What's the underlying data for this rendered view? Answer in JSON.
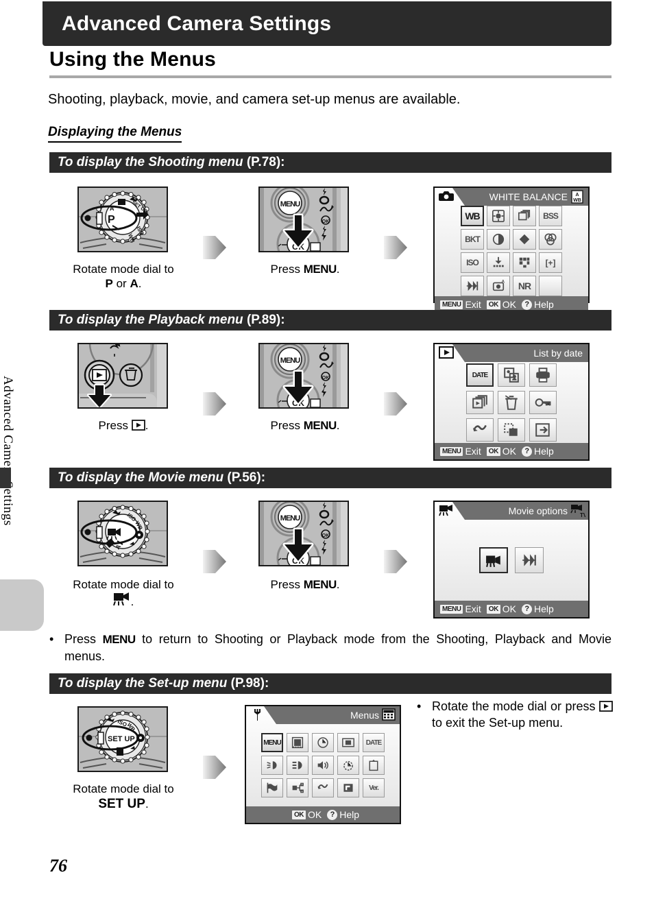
{
  "sidebar": {
    "vertical_label": "Advanced Camera Settings"
  },
  "header": {
    "chapter": "Advanced Camera Settings",
    "title": "Using the Menus",
    "intro": "Shooting, playback, movie, and camera set-up menus are available.",
    "subhead": "Displaying the Menus"
  },
  "page_number": "76",
  "sections": [
    {
      "id": "shooting",
      "bar_label": "To display the Shooting menu",
      "bar_page": "(P.78):",
      "steps": [
        {
          "caption_line1": "Rotate mode dial to",
          "caption_line2_pre": "",
          "caption_bold": "P",
          "caption_mid": " or ",
          "caption_bold2": "A",
          "caption_end": "."
        },
        {
          "caption_line1": "Press",
          "caption_key": "MENU",
          "caption_end": "."
        }
      ],
      "dial_selected": "P",
      "dial_labels": [
        "P",
        "A",
        "SET UP",
        "ISO",
        "WB"
      ],
      "lcd": {
        "mode_icon": "camera-icon",
        "title": "WHITE BALANCE",
        "right_icon": "auto-wb-icon",
        "columns": 4,
        "cells": [
          {
            "glyph": "WB",
            "name": "white-balance",
            "selected": true
          },
          {
            "glyph": "metering",
            "name": "metering",
            "selected": false
          },
          {
            "glyph": "continuous",
            "name": "continuous",
            "selected": false
          },
          {
            "glyph": "BSS",
            "name": "best-shot-selector",
            "selected": false
          },
          {
            "glyph": "BKT",
            "name": "bracketing",
            "selected": false
          },
          {
            "glyph": "contrast",
            "name": "image-adjustment",
            "selected": false
          },
          {
            "glyph": "sharpness",
            "name": "image-sharpening",
            "selected": false
          },
          {
            "glyph": "saturation",
            "name": "saturation-control",
            "selected": false
          },
          {
            "glyph": "ISO",
            "name": "iso-sensitivity",
            "selected": false
          },
          {
            "glyph": "imagequality",
            "name": "image-quality",
            "selected": false
          },
          {
            "glyph": "imagesize",
            "name": "image-size",
            "selected": false
          },
          {
            "glyph": "afarea",
            "name": "af-area-mode",
            "selected": false
          },
          {
            "glyph": "convertor",
            "name": "lens-convertor",
            "selected": false
          },
          {
            "glyph": "auto-bracket",
            "name": "auto-exposure",
            "selected": false
          },
          {
            "glyph": "NR",
            "name": "noise-reduction",
            "selected": false
          },
          {
            "glyph": "",
            "name": "empty-cell",
            "selected": false
          }
        ],
        "footer": [
          {
            "key": "MENU",
            "label": "Exit"
          },
          {
            "key": "OK",
            "label": "OK"
          },
          {
            "key": "?",
            "label": "Help"
          }
        ]
      }
    },
    {
      "id": "playback",
      "bar_label": "To display the Playback menu",
      "bar_page": "(P.89):",
      "steps": [
        {
          "caption_line1": "Press",
          "caption_key": "playback-icon",
          "caption_end": "."
        },
        {
          "caption_line1": "Press",
          "caption_key": "MENU",
          "caption_end": "."
        }
      ],
      "lcd": {
        "mode_icon": "playback-icon",
        "title": "List by date",
        "right_icon": "",
        "columns": 3,
        "cells": [
          {
            "glyph": "DATE",
            "name": "list-by-date",
            "selected": true
          },
          {
            "glyph": "slideshow-copy",
            "name": "small-picture",
            "selected": false
          },
          {
            "glyph": "printset",
            "name": "print-set",
            "selected": false
          },
          {
            "glyph": "slideshow",
            "name": "slide-show",
            "selected": false
          },
          {
            "glyph": "delete",
            "name": "delete",
            "selected": false
          },
          {
            "glyph": "protect",
            "name": "protect",
            "selected": false
          },
          {
            "glyph": "dscan",
            "name": "d-lighting",
            "selected": false
          },
          {
            "glyph": "resize",
            "name": "small-picture-resize",
            "selected": false
          },
          {
            "glyph": "copy",
            "name": "copy",
            "selected": false
          }
        ],
        "footer": [
          {
            "key": "MENU",
            "label": "Exit"
          },
          {
            "key": "OK",
            "label": "OK"
          },
          {
            "key": "?",
            "label": "Help"
          }
        ]
      }
    },
    {
      "id": "movie",
      "bar_label": "To display the Movie menu",
      "bar_page": "(P.56):",
      "steps": [
        {
          "caption_line1": "Rotate mode dial to",
          "caption_key": "movie-icon",
          "caption_end": "."
        },
        {
          "caption_line1": "Press",
          "caption_key": "MENU",
          "caption_end": "."
        }
      ],
      "lcd": {
        "mode_icon": "movie-icon",
        "title": "Movie options",
        "right_icon": "tv-movie-icon",
        "columns": 2,
        "cells": [
          {
            "glyph": "movie",
            "name": "movie-option",
            "selected": true
          },
          {
            "glyph": "convertor",
            "name": "electronic-vr",
            "selected": false
          }
        ],
        "footer": [
          {
            "key": "MENU",
            "label": "Exit"
          },
          {
            "key": "OK",
            "label": "OK"
          },
          {
            "key": "?",
            "label": "Help"
          }
        ]
      }
    },
    {
      "id": "setup",
      "bar_label": "To display the Set-up menu",
      "bar_page": "(P.98):",
      "steps": [
        {
          "caption_line1": "Rotate mode dial to",
          "caption_bold": "SET UP",
          "caption_end": "."
        }
      ],
      "lcd": {
        "mode_icon": "wrench-icon",
        "title": "Menus",
        "right_icon": "menus-grid-icon",
        "columns": 5,
        "cells": [
          {
            "glyph": "MENU",
            "name": "menus",
            "selected": true
          },
          {
            "glyph": "welcome",
            "name": "welcome-screen",
            "selected": false
          },
          {
            "glyph": "clock",
            "name": "date",
            "selected": false
          },
          {
            "glyph": "monitor",
            "name": "monitor-settings",
            "selected": false
          },
          {
            "glyph": "DATE",
            "name": "date-imprint",
            "selected": false
          },
          {
            "glyph": "brightness",
            "name": "brightness",
            "selected": false
          },
          {
            "glyph": "af-assist",
            "name": "af-assist",
            "selected": false
          },
          {
            "glyph": "sound",
            "name": "sound-settings",
            "selected": false
          },
          {
            "glyph": "autooff",
            "name": "auto-off",
            "selected": false
          },
          {
            "glyph": "format",
            "name": "format-memory",
            "selected": false
          },
          {
            "glyph": "language",
            "name": "language",
            "selected": false
          },
          {
            "glyph": "usb",
            "name": "interface-usb",
            "selected": false
          },
          {
            "glyph": "dscan",
            "name": "reset-all",
            "selected": false
          },
          {
            "glyph": "cfg",
            "name": "controls",
            "selected": false
          },
          {
            "glyph": "Ver.",
            "name": "firmware-version",
            "selected": false
          }
        ],
        "footer": [
          {
            "key": "OK",
            "label": "OK"
          },
          {
            "key": "?",
            "label": "Help"
          }
        ]
      }
    }
  ],
  "notes": {
    "movie_note_pre": "Press",
    "movie_note_key": "MENU",
    "movie_note_post": "to return to Shooting or Playback mode from the Shooting, Playback and Movie menus.",
    "setup_note_pre": "Rotate the mode dial or press",
    "setup_note_key": "playback-icon",
    "setup_note_post": "to exit the Set-up menu."
  }
}
